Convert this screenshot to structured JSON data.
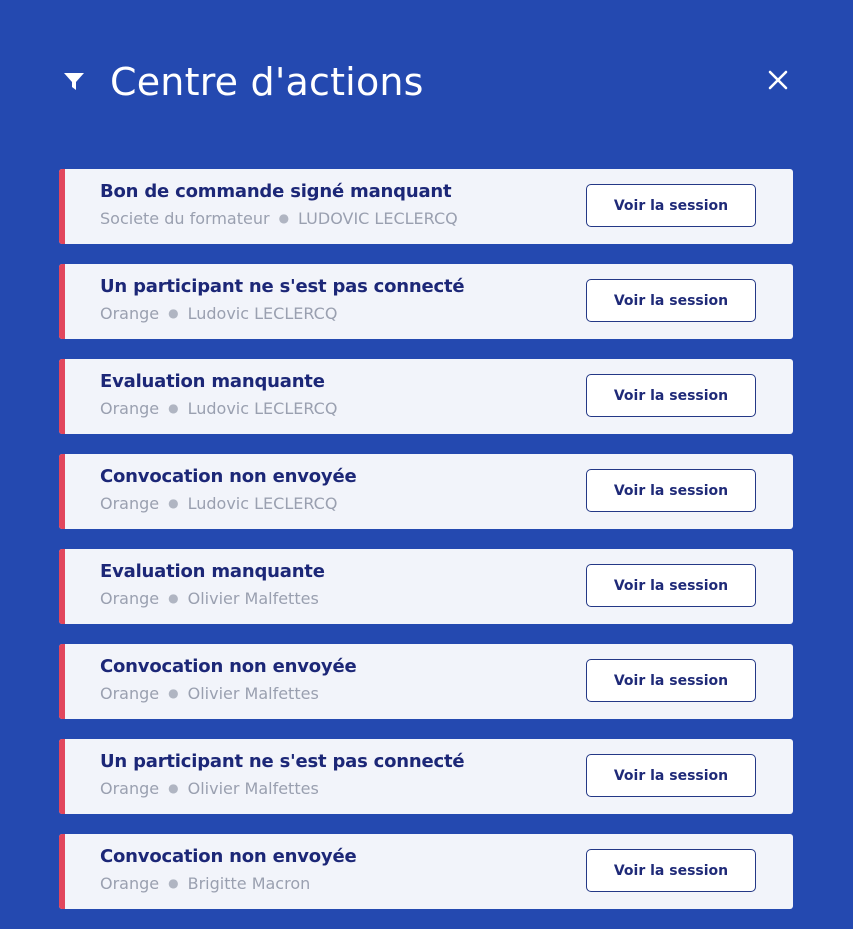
{
  "header": {
    "title": "Centre d'actions",
    "filter_icon": "filter-icon",
    "close_icon": "close-icon"
  },
  "colors": {
    "background": "#2449b0",
    "card_background": "#f2f4fa",
    "accent": "#e2465c",
    "title_text": "#1c2777",
    "subtitle_text": "#9aa0b0"
  },
  "actions": [
    {
      "title": "Bon de commande signé manquant",
      "company": "Societe du formateur",
      "person": "LUDOVIC LECLERCQ",
      "button": "Voir la session"
    },
    {
      "title": "Un participant ne s'est pas connecté",
      "company": "Orange",
      "person": "Ludovic LECLERCQ",
      "button": "Voir la session"
    },
    {
      "title": "Evaluation manquante",
      "company": "Orange",
      "person": "Ludovic LECLERCQ",
      "button": "Voir la session"
    },
    {
      "title": "Convocation non envoyée",
      "company": "Orange",
      "person": "Ludovic LECLERCQ",
      "button": "Voir la session"
    },
    {
      "title": "Evaluation manquante",
      "company": "Orange",
      "person": "Olivier Malfettes",
      "button": "Voir la session"
    },
    {
      "title": "Convocation non envoyée",
      "company": "Orange",
      "person": "Olivier Malfettes",
      "button": "Voir la session"
    },
    {
      "title": "Un participant ne s'est pas connecté",
      "company": "Orange",
      "person": "Olivier Malfettes",
      "button": "Voir la session"
    },
    {
      "title": "Convocation non envoyée",
      "company": "Orange",
      "person": "Brigitte Macron",
      "button": "Voir la session"
    }
  ]
}
